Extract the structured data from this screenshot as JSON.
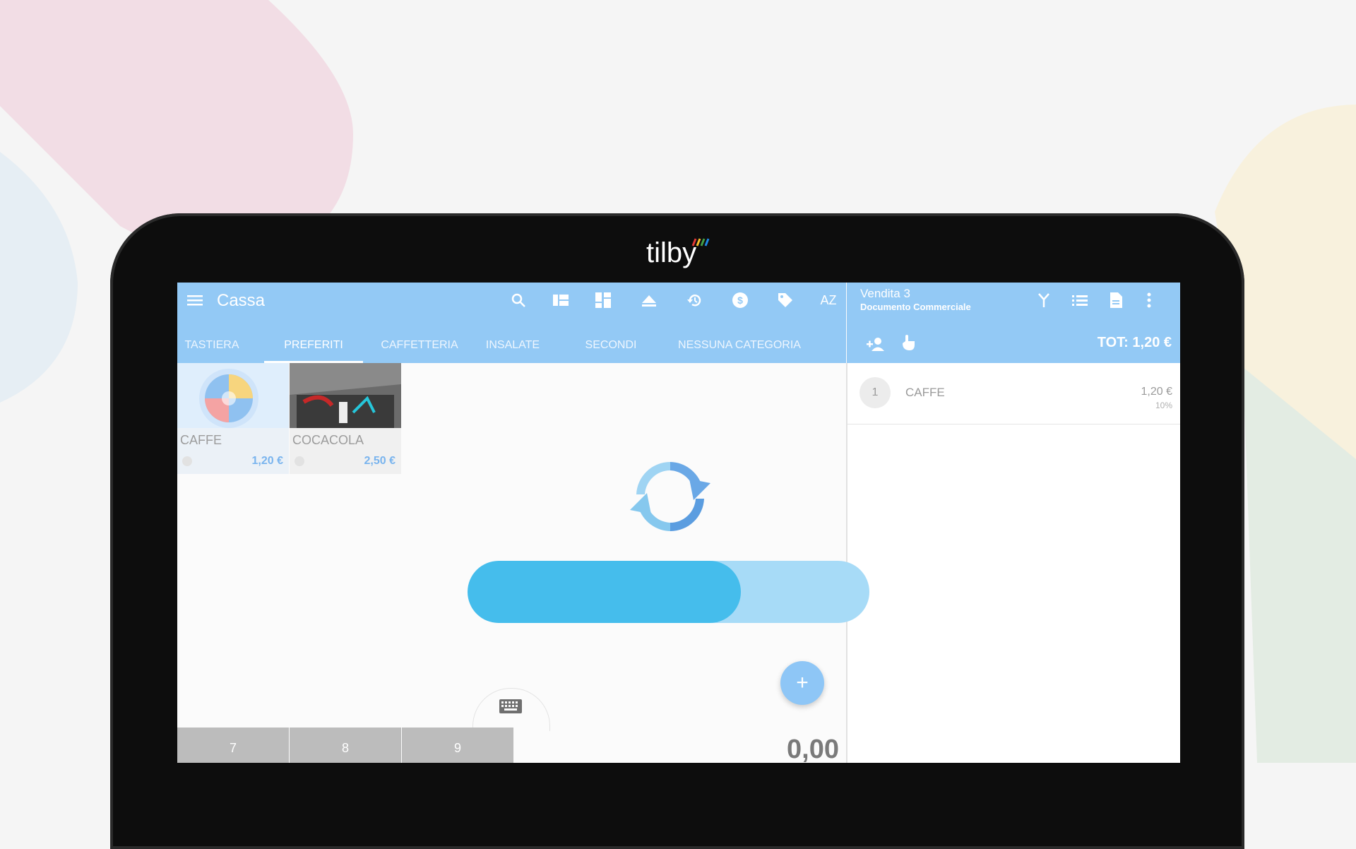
{
  "brand": {
    "logo_text": "tilby"
  },
  "header": {
    "menu_icon": "menu-icon",
    "title": "Cassa",
    "actions": [
      "search-icon",
      "view-list-icon",
      "dashboard-icon",
      "eject-icon",
      "history-icon",
      "currency-icon",
      "price-tag-icon",
      "sort-az-icon"
    ],
    "sort_label": "AZ"
  },
  "tabs": [
    {
      "label": "TASTIERA",
      "active": false
    },
    {
      "label": "PREFERITI",
      "active": true
    },
    {
      "label": "CAFFETTERIA",
      "active": false
    },
    {
      "label": "INSALATE",
      "active": false
    },
    {
      "label": "SECONDI",
      "active": false
    },
    {
      "label": "NESSUNA CATEGORIA",
      "active": false
    }
  ],
  "products": [
    {
      "name": "CAFFE",
      "price": "1,20 €"
    },
    {
      "name": "COCACOLA",
      "price": "2,50 €"
    }
  ],
  "keypad": {
    "keys": [
      "7",
      "8",
      "9"
    ],
    "amount": "0,00"
  },
  "fab": {
    "label": "+"
  },
  "sale": {
    "title": "Vendita 3",
    "subtitle": "Documento Commerciale",
    "actions": [
      "split-icon",
      "list-icon",
      "document-icon",
      "more-vert-icon"
    ],
    "total": "TOT: 1,20 €",
    "customer_icons": [
      "add-customer-icon",
      "touch-icon"
    ],
    "items": [
      {
        "qty": "1",
        "name": "CAFFE",
        "price": "1,20 €",
        "vat": "10%"
      }
    ]
  },
  "loading": {
    "progress": 0.68
  },
  "colors": {
    "toolbar": "#93c9f5",
    "accent": "#79b4ee",
    "progress_fill": "#45bdec",
    "progress_track": "#a7dbf7"
  }
}
